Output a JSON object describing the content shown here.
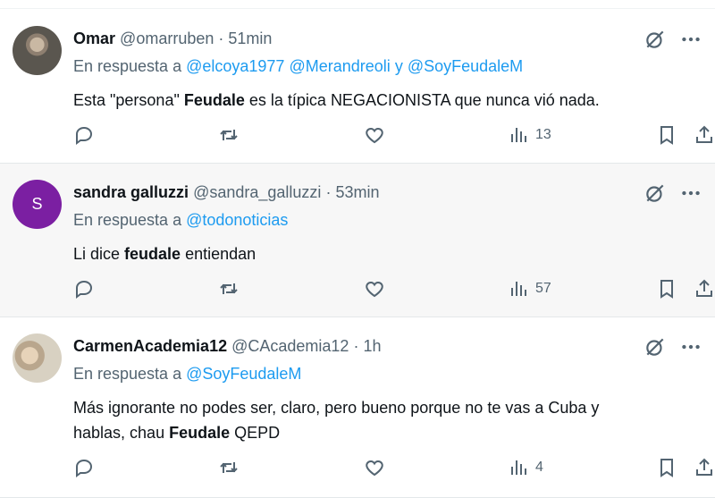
{
  "posts": [
    {
      "name": "Omar",
      "handle": "@omarruben",
      "dot": "·",
      "time": "51min",
      "reply_prefix": "En respuesta a",
      "mentions": [
        "@elcoya1977",
        "@Merandreoli",
        "y",
        "@SoyFeudaleM"
      ],
      "text_parts": [
        "Esta \"persona\" ",
        "Feudale",
        " es la típica NEGACIONISTA que nunca vió nada."
      ],
      "views": "13"
    },
    {
      "name": "sandra galluzzi",
      "handle": "@sandra_galluzzi",
      "dot": "·",
      "time": "53min",
      "avatar_letter": "S",
      "reply_prefix": "En respuesta a",
      "mentions": [
        "@todonoticias"
      ],
      "text_parts": [
        "Li dice ",
        "feudale",
        " entiendan"
      ],
      "views": "57"
    },
    {
      "name": "CarmenAcademia12",
      "handle": "@CAcademia12",
      "dot": "·",
      "time": "1h",
      "reply_prefix": "En respuesta a",
      "mentions": [
        "@SoyFeudaleM"
      ],
      "text_line1": "Más ignorante no podes ser, claro, pero bueno porque no te vas a Cuba y",
      "text_line2_parts": [
        "hablas, chau ",
        "Feudale",
        " QEPD"
      ],
      "views": "4"
    }
  ],
  "icons": {
    "reply": "reply-icon",
    "retweet": "retweet-icon",
    "like": "heart-icon",
    "views": "views-icon",
    "bookmark": "bookmark-icon",
    "share": "share-icon",
    "grok": "grok-icon",
    "more": "more-icon"
  },
  "colors": {
    "text": "#0f1419",
    "muted": "#536471",
    "link": "#1d9bf0",
    "avatar_s": "#7b1fa2"
  }
}
